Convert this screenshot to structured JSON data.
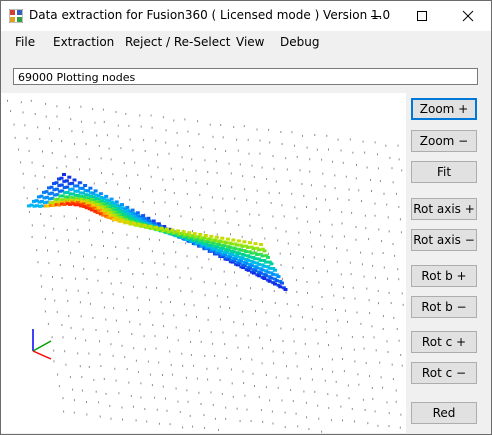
{
  "window": {
    "title": "Data extraction for Fusion360  ( Licensed mode )  Version 1.0",
    "minimize_icon": "minimize-icon",
    "maximize_icon": "maximize-icon",
    "close_icon": "close-icon"
  },
  "menu": {
    "items": [
      "File",
      "Extraction",
      "Reject / Re-Select",
      "View",
      "Debug"
    ]
  },
  "status": {
    "text": "69000 Plotting nodes"
  },
  "buttons": {
    "zoom_in": "Zoom +",
    "zoom_out": "Zoom −",
    "fit": "Fit",
    "rot_axis_plus": "Rot axis +",
    "rot_axis_minus": "Rot axis −",
    "rot_b_plus": "Rot b +",
    "rot_b_minus": "Rot b −",
    "rot_c_plus": "Rot c +",
    "rot_c_minus": "Rot c −",
    "red": "Red"
  },
  "colors": {
    "focus_border": "#0078d7",
    "axis_x": "#ff0000",
    "axis_y": "#00a000",
    "axis_z": "#0000ff"
  }
}
